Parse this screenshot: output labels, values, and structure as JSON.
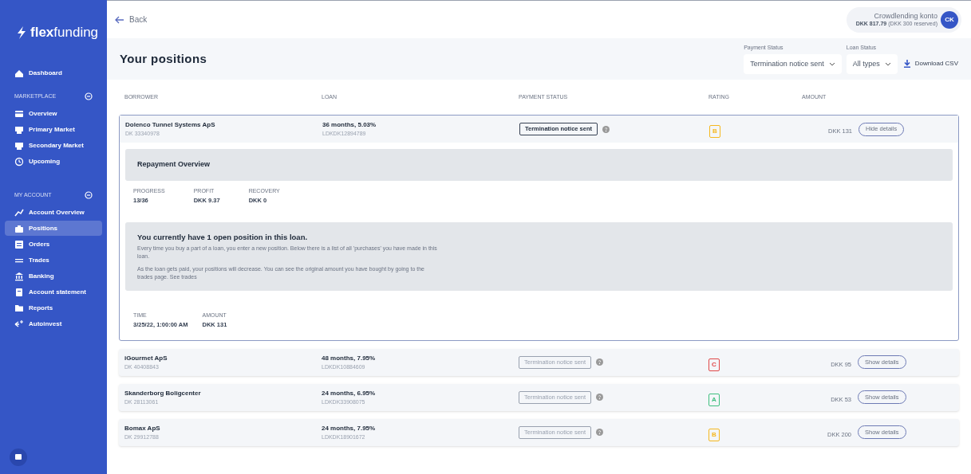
{
  "brand": {
    "name_bold": "flex",
    "name_light": "funding"
  },
  "sidebar": {
    "top_item": {
      "label": "Dashboard",
      "selected": false
    },
    "sections": [
      {
        "title": "MARKETPLACE",
        "expanded": true,
        "items": [
          {
            "label": "Overview",
            "selected": false
          },
          {
            "label": "Primary Market",
            "selected": false
          },
          {
            "label": "Secondary Market",
            "selected": false
          },
          {
            "label": "Upcoming",
            "selected": false
          }
        ]
      },
      {
        "title": "MY ACCOUNT",
        "expanded": true,
        "items": [
          {
            "label": "Account Overview",
            "selected": false
          },
          {
            "label": "Positions",
            "selected": true
          },
          {
            "label": "Orders",
            "selected": false
          },
          {
            "label": "Trades",
            "selected": false
          },
          {
            "label": "Banking",
            "selected": false
          },
          {
            "label": "Account statement",
            "selected": false
          },
          {
            "label": "Reports",
            "selected": false
          },
          {
            "label": "Autoinvest",
            "selected": false
          }
        ]
      }
    ]
  },
  "top_bar": {
    "back": "Back",
    "account": {
      "name": "Crowdlending konto",
      "balance": "DKK 817.79",
      "reserved": "(DKK 300 reserved)",
      "initials": "CK"
    }
  },
  "header": {
    "title": "Your positions",
    "filters": [
      {
        "label": "Payment Status",
        "value": "Termination notice sent"
      },
      {
        "label": "Loan Status",
        "value": "All types"
      }
    ],
    "download": "Download CSV"
  },
  "table": {
    "columns": [
      "BORROWER",
      "LOAN",
      "PAYMENT STATUS",
      "RATING",
      "AMOUNT"
    ],
    "rows": [
      {
        "borrower": "Dolenco Tunnel Systems ApS",
        "borrower_id": "DK 33340978",
        "loan": "36 months, 5.03%",
        "loan_id": "LDKDK12894789",
        "status": "Termination notice sent",
        "rating": "B",
        "color": "#f5b820",
        "amount": "DKK 131",
        "toggle": "Hide details",
        "expanded": true,
        "details": {
          "title": "Repayment Overview",
          "stats": [
            {
              "label": "PROGRESS",
              "value": "13/36"
            },
            {
              "label": "PROFIT",
              "value": "DKK 9.37"
            },
            {
              "label": "RECOVERY",
              "value": "DKK 0"
            }
          ],
          "info_title": "You currently have 1 open position in this loan.",
          "info_paragraphs": [
            "Every time you buy a part of a loan, you enter a new position. Below there is a list of all 'purchases' you have made in this loan.",
            "As the loan gets paid, your positions will decrease. You can see the original amount you have bought by going to the trades page. See trades"
          ],
          "positions": [
            {
              "label": "TIME",
              "value": "3/25/22, 1:00:00 AM"
            },
            {
              "label": "AMOUNT",
              "value": "DKK 131"
            }
          ]
        }
      },
      {
        "borrower": "iGourmet ApS",
        "borrower_id": "DK 40408843",
        "loan": "48 months, 7.95%",
        "loan_id": "LDKDK10884609",
        "status": "Termination notice sent",
        "rating": "C",
        "color": "#e04848",
        "amount": "DKK 95",
        "toggle": "Show details",
        "expanded": false
      },
      {
        "borrower": "Skanderborg Boligcenter",
        "borrower_id": "DK 28113061",
        "loan": "24 months, 6.95%",
        "loan_id": "LDKDK33908075",
        "status": "Termination notice sent",
        "rating": "A",
        "color": "#3fbf7f",
        "amount": "DKK 53",
        "toggle": "Show details",
        "expanded": false
      },
      {
        "borrower": "Bomax ApS",
        "borrower_id": "DK 29912788",
        "loan": "24 months, 7.95%",
        "loan_id": "LDKDK18901672",
        "status": "Termination notice sent",
        "rating": "B",
        "color": "#f5b820",
        "amount": "DKK 200",
        "toggle": "Show details",
        "expanded": false
      }
    ]
  }
}
